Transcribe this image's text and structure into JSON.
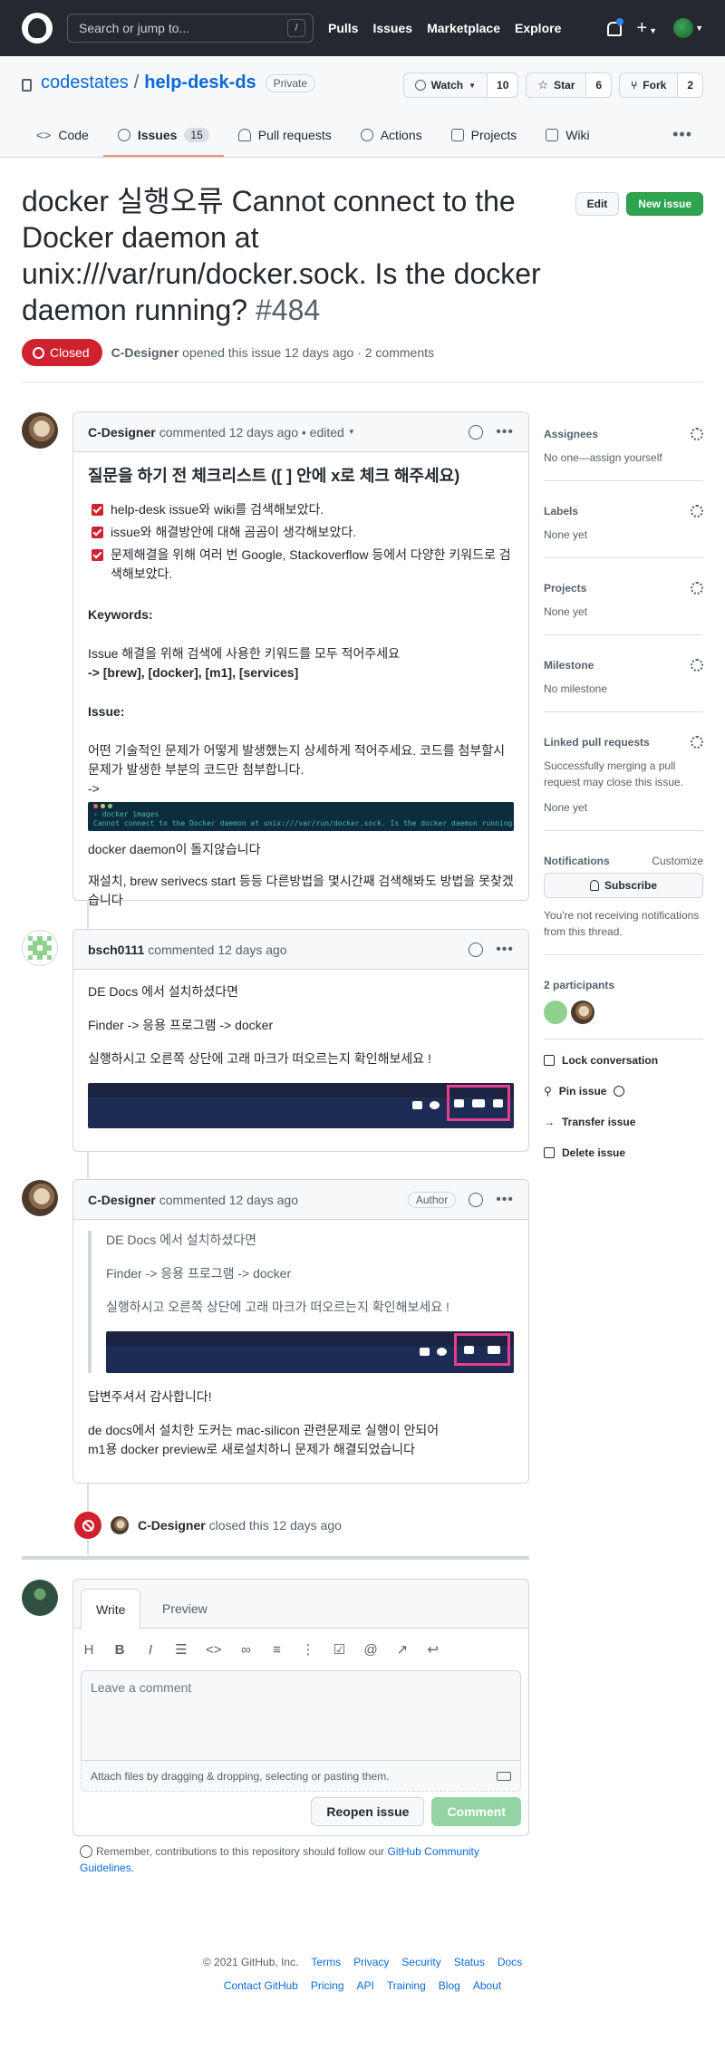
{
  "header": {
    "search_placeholder": "Search or jump to...",
    "search_key": "/",
    "nav": [
      "Pulls",
      "Issues",
      "Marketplace",
      "Explore"
    ],
    "plus": "+"
  },
  "repo": {
    "owner": "codestates",
    "separator": "/",
    "name": "help-desk-ds",
    "visibility": "Private",
    "watch_label": "Watch",
    "watch_count": "10",
    "star_label": "Star",
    "star_count": "6",
    "fork_label": "Fork",
    "fork_count": "2",
    "tabs": [
      {
        "label": "Code"
      },
      {
        "label": "Issues",
        "count": "15"
      },
      {
        "label": "Pull requests"
      },
      {
        "label": "Actions"
      },
      {
        "label": "Projects"
      },
      {
        "label": "Wiki"
      }
    ]
  },
  "issue": {
    "title": "docker 실행오류 Cannot connect to the Docker daemon at unix:///var/run/docker.sock. Is the docker daemon running?",
    "number": "#484",
    "edit_label": "Edit",
    "new_issue_label": "New issue",
    "state": "Closed",
    "author": "C-Designer",
    "meta": "opened this issue 12 days ago · 2 comments"
  },
  "comments": [
    {
      "author": "C-Designer",
      "meta": "commented 12 days ago • edited",
      "heading": "질문을 하기 전 체크리스트 ([ ] 안에 x로 체크 해주세요)",
      "tasks": [
        "help-desk issue와 wiki를 검색해보았다.",
        "issue와 해결방안에 대해 곰곰이 생각해보았다.",
        "문제해결을 위해 여러 번 Google, Stackoverflow 등에서 다양한 키워드로 검색해보았다."
      ],
      "keywords_label": "Keywords:",
      "keywords_desc": "Issue 해결을 위해 검색에 사용한 키워드를 모두 적어주세요",
      "keywords_value": "-> [brew], [docker], [m1], [services]",
      "issue_label": "Issue:",
      "issue_desc": "어떤 기술적인 문제가 어떻게 발생했는지 상세하게 적어주세요. 코드를 첨부할시 문제가 발생한 부분의 코드만 첨부합니다.",
      "arrow": "->",
      "terminal_cmd": "› docker images",
      "terminal_out": "Cannot connect to the Docker daemon at unix:///var/run/docker.sock. Is the docker daemon running?",
      "line1": "docker daemon이 돌지않습니다",
      "line2": "재설치, brew serivecs start 등등 다른방법을 몇시간째 검색해봐도 방법을 못찾겠습니다"
    },
    {
      "author": "bsch0111",
      "meta": "commented 12 days ago",
      "p1": "DE Docs 에서 설치하셨다면",
      "p2": "Finder -> 응용 프로그램 -> docker",
      "p3": "실행하시고 오른쪽 상단에 고래 마크가 떠오르는지 확인해보세요 !"
    },
    {
      "author": "C-Designer",
      "meta": "commented 12 days ago",
      "badge": "Author",
      "q1": "DE Docs 에서 설치하셨다면",
      "q2": "Finder -> 응용 프로그램 -> docker",
      "q3": "실행하시고 오른쪽 상단에 고래 마크가 떠오르는지 확인해보세요 !",
      "p1": "답변주셔서 감사합니다!",
      "p2": "de docs에서 설치한 도커는 mac-silicon 관련문제로 실행이 안되어",
      "p3": "m1용 docker preview로 새로설치하니 문제가 해결되었습니다"
    }
  ],
  "event": {
    "author": "C-Designer",
    "text": "closed this 12 days ago"
  },
  "form": {
    "tab_write": "Write",
    "tab_preview": "Preview",
    "placeholder": "Leave a comment",
    "attach": "Attach files by dragging & dropping, selecting or pasting them.",
    "reopen": "Reopen issue",
    "comment": "Comment"
  },
  "note": {
    "text": "Remember, contributions to this repository should follow our",
    "link": "GitHub Community Guidelines",
    "end": "."
  },
  "sidebar": {
    "assignees": {
      "title": "Assignees",
      "text": "No one—assign yourself"
    },
    "labels": {
      "title": "Labels",
      "text": "None yet"
    },
    "projects": {
      "title": "Projects",
      "text": "None yet"
    },
    "milestone": {
      "title": "Milestone",
      "text": "No milestone"
    },
    "linked": {
      "title": "Linked pull requests",
      "text": "Successfully merging a pull request may close this issue.",
      "text2": "None yet"
    },
    "notifications": {
      "title": "Notifications",
      "customize": "Customize",
      "subscribe": "Subscribe",
      "text": "You're not receiving notifications from this thread."
    },
    "participants": {
      "title": "2 participants"
    },
    "actions": [
      "Lock conversation",
      "Pin issue",
      "Transfer issue",
      "Delete issue"
    ]
  },
  "footer": {
    "copyright": "© 2021 GitHub, Inc.",
    "row1": [
      "Terms",
      "Privacy",
      "Security",
      "Status",
      "Docs"
    ],
    "row2": [
      "Contact GitHub",
      "Pricing",
      "API",
      "Training",
      "Blog",
      "About"
    ]
  },
  "colors": {
    "closed": "#cf222e",
    "link": "#0969da",
    "green": "#2da44e",
    "tab_underline": "#fd8c73"
  }
}
